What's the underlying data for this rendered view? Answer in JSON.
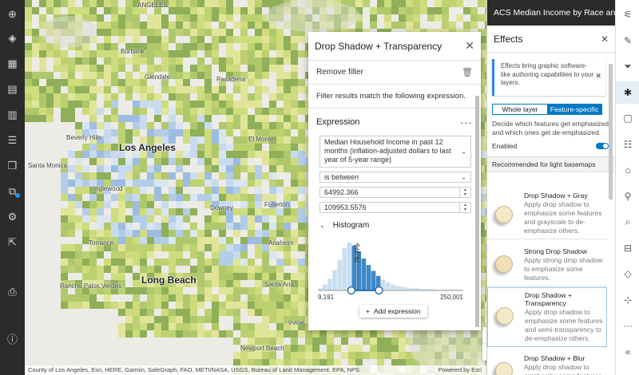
{
  "left_toolbar": [
    {
      "icon": "add-icon",
      "glyph": "⊕"
    },
    {
      "icon": "layers-icon",
      "glyph": "◈"
    },
    {
      "icon": "table-icon",
      "glyph": "▦"
    },
    {
      "icon": "legend-icon",
      "glyph": "▤"
    },
    {
      "icon": "charts-icon",
      "glyph": "▥"
    },
    {
      "icon": "list-icon",
      "glyph": "☰"
    },
    {
      "icon": "bookmark-icon",
      "glyph": "❒"
    },
    {
      "icon": "basemap-icon",
      "glyph": "⧉"
    },
    {
      "icon": "settings-icon",
      "glyph": "⚙"
    },
    {
      "icon": "share-icon",
      "glyph": "⇱"
    },
    {
      "icon": "print-icon",
      "glyph": "⎙"
    },
    {
      "icon": "info-icon",
      "glyph": "ⓘ"
    }
  ],
  "map": {
    "labels": {
      "angeles": "ANGELES",
      "glendale": "Glendale",
      "burbank": "Burbank",
      "pasadena": "Pasadena",
      "el_monte": "El Monte",
      "los_angeles": "Los Angeles",
      "beverly_hills": "Beverly Hills",
      "santa_monica": "Santa Monica",
      "inglewood": "Inglewood",
      "downey": "Downey",
      "torrance": "Torrance",
      "long_beach": "Long Beach",
      "palos_verdes": "Rancho Palos Verdes",
      "santa_ana": "Santa Ana",
      "irvine": "Irvine",
      "newport": "Newport Beach",
      "anaheim": "Anaheim",
      "fullerton": "Fullerton"
    },
    "attribution": "County of Los Angeles, Esri, HERE, Garmin, SafeGraph, FAO, METI/NASA, USGS, Bureau of Land Management, EPA, NPS",
    "powered_by": "Powered by Esri",
    "zoom_in": "+",
    "zoom_out": "−"
  },
  "filter_panel": {
    "title": "Drop Shadow + Transparency",
    "remove_filter": "Remove filter",
    "match_note": "Filter results match the following expression.",
    "expression_heading": "Expression",
    "field": "Median Household Income in past 12 months (inflation-adjusted dollars to last year of 5-year range)",
    "operator": "is between",
    "value_min": "64992.366",
    "value_max": "109953.5576",
    "histogram_heading": "Histogram",
    "histogram_min": "9,191",
    "histogram_max": "250,001",
    "histogram_mean_label": "76,975",
    "histogram_bins": [
      3,
      8,
      16,
      28,
      42,
      58,
      66,
      62,
      54,
      44,
      35,
      27,
      20,
      15,
      11,
      8,
      6,
      5,
      4,
      3,
      3,
      2,
      2,
      2,
      1,
      1,
      1,
      1,
      1,
      1
    ],
    "histogram_selected_range": [
      0.23,
      0.42
    ],
    "add_expression": "Add expression"
  },
  "effects_panel": {
    "layer_title": "ACS Median Income by Race an",
    "title": "Effects",
    "notice": "Effects bring graphic software-like authoring capabilities to your layers.",
    "tab_whole": "Whole layer",
    "tab_feature": "Feature-specific",
    "description": "Decide which features get emphasized and which ones get de-emphasized.",
    "enabled_label": "Enabled",
    "enabled": true,
    "recommended": "Recommended for light basemaps",
    "cards": [
      {
        "title": "Drop Shadow + Gray",
        "desc": "Apply drop shadow to emphasize some features and grayscale to de-emphasize others."
      },
      {
        "title": "Strong Drop Shadow",
        "desc": "Apply strong drop shadow to emphasize some features."
      },
      {
        "title": "Drop Shadow + Transparency",
        "desc": "Apply drop shadow to emphasize some features and semi-transparency to de-emphasize others."
      },
      {
        "title": "Drop Shadow + Blur",
        "desc": "Apply drop shadow to emphasize some features"
      }
    ]
  },
  "right_toolbar": [
    {
      "icon": "properties-icon",
      "glyph": "⚟"
    },
    {
      "icon": "styles-icon",
      "glyph": "✎"
    },
    {
      "icon": "filter-icon",
      "glyph": "⏷"
    },
    {
      "icon": "effects-icon",
      "glyph": "✱"
    },
    {
      "icon": "popups-icon",
      "glyph": "▢"
    },
    {
      "icon": "fields-icon",
      "glyph": "☷"
    },
    {
      "icon": "labels-icon",
      "glyph": "⌂"
    },
    {
      "icon": "config-icon",
      "glyph": "⚲"
    },
    {
      "icon": "search-icon",
      "glyph": "⌕"
    },
    {
      "icon": "measure-icon",
      "glyph": "⊟"
    },
    {
      "icon": "directions-icon",
      "glyph": "◇"
    },
    {
      "icon": "locate-icon",
      "glyph": "⊹"
    },
    {
      "icon": "more-icon",
      "glyph": "···"
    },
    {
      "icon": "collapse-icon",
      "glyph": "«"
    }
  ]
}
